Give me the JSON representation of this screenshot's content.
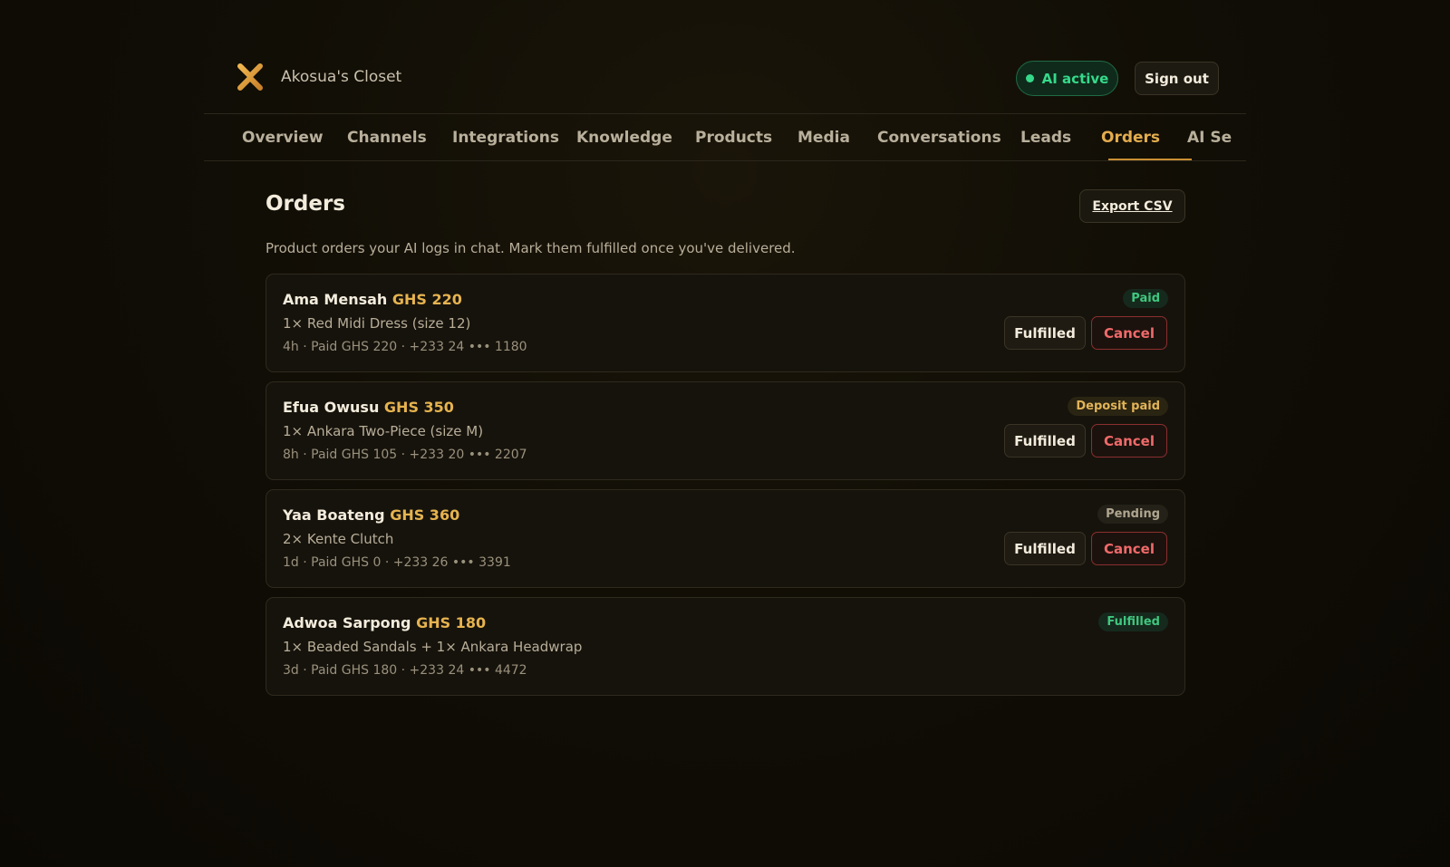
{
  "brand": {
    "name": "Akosua's Closet",
    "logo_icon": "x-logo-icon",
    "logo_color": "#d99a3c"
  },
  "header": {
    "ai_status": "AI active",
    "sign_out": "Sign out"
  },
  "nav": {
    "tabs": [
      {
        "label": "Overview"
      },
      {
        "label": "Channels"
      },
      {
        "label": "Integrations"
      },
      {
        "label": "Knowledge"
      },
      {
        "label": "Products"
      },
      {
        "label": "Media"
      },
      {
        "label": "Conversations"
      },
      {
        "label": "Leads"
      },
      {
        "label": "Orders"
      },
      {
        "label": "AI Se"
      }
    ],
    "active": "Orders"
  },
  "page": {
    "title": "Orders",
    "export_label": "Export CSV",
    "subtitle": "Product orders your AI logs in chat. Mark them fulfilled once you've delivered."
  },
  "orders": [
    {
      "name": "Ama Mensah",
      "amount": "GHS 220",
      "items": "1× Red Midi Dress (size 12)",
      "meta": "4h · Paid GHS 220 · +233 24 ••• 1180",
      "status": "Paid",
      "fulfilled_label": "Fulfilled",
      "cancel_label": "Cancel"
    },
    {
      "name": "Efua Owusu",
      "amount": "GHS 350",
      "items": "1× Ankara Two-Piece (size M)",
      "meta": "8h · Paid GHS 105 · +233 20 ••• 2207",
      "status": "Deposit paid",
      "fulfilled_label": "Fulfilled",
      "cancel_label": "Cancel"
    },
    {
      "name": "Yaa Boateng",
      "amount": "GHS 360",
      "items": "2× Kente Clutch",
      "meta": "1d · Paid GHS 0 · +233 26 ••• 3391",
      "status": "Pending",
      "fulfilled_label": "Fulfilled",
      "cancel_label": "Cancel"
    },
    {
      "name": "Adwoa Sarpong",
      "amount": "GHS 180",
      "items": "1× Beaded Sandals + 1× Ankara Headwrap",
      "meta": "3d · Paid GHS 180 · +233 24 ••• 4472",
      "status": "Fulfilled"
    }
  ],
  "colors": {
    "accent": "#e3ad4e",
    "success": "#36d98a",
    "danger": "#f06a6a"
  }
}
